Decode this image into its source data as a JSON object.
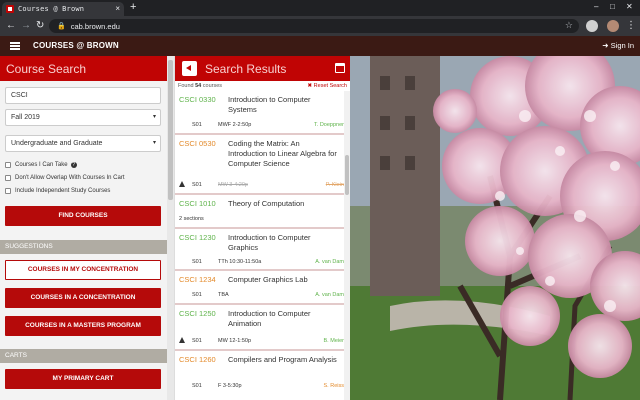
{
  "browser": {
    "tab_title": "Courses @ Brown",
    "tab_close": "×",
    "new_tab": "+",
    "win_min": "–",
    "win_max": "□",
    "win_close": "✕",
    "url": "cab.brown.edu",
    "lock_glyph": "🔒",
    "star_glyph": "☆",
    "back_glyph": "←",
    "forward_glyph": "→",
    "reload_glyph": "↻"
  },
  "header": {
    "brand": "COURSES @ BROWN",
    "signin": "➜ Sign In"
  },
  "search": {
    "title": "Course Search",
    "keyword_value": "CSCI",
    "term_value": "Fall 2019",
    "level_value": "Undergraduate and Graduate",
    "check_can_take": "Courses I Can Take",
    "check_no_overlap": "Don't Allow Overlap With Courses In Cart",
    "check_independent": "Include Independent Study Courses",
    "find_button": "FIND COURSES",
    "help_glyph": "?",
    "caret_glyph": "▾"
  },
  "suggestions": {
    "heading": "SUGGESTIONS",
    "items": [
      "COURSES IN MY CONCENTRATION",
      "COURSES IN A CONCENTRATION",
      "COURSES IN A MASTERS PROGRAM"
    ]
  },
  "carts": {
    "heading": "CARTS",
    "primary": "MY PRIMARY CART"
  },
  "results": {
    "title": "Search Results",
    "found_prefix": "Found ",
    "found_count": "54",
    "found_suffix": " courses",
    "reset": "✖ Reset Search",
    "items": [
      {
        "code": "CSCI 0330",
        "title": "Introduction to Computer Systems",
        "section": "S01",
        "time": "MWF 2-2:50p",
        "instructor": "T. Doeppner",
        "code_color": "green",
        "inst_color": "green",
        "warn": false,
        "strike": false,
        "sections_text": ""
      },
      {
        "code": "CSCI 0530",
        "title": "Coding the Matrix: An Introduction to Linear Algebra for Computer Science",
        "section": "S01",
        "time": "MW 3-4:20p",
        "instructor": "P. Klein",
        "code_color": "orange",
        "inst_color": "orange",
        "warn": true,
        "strike": true,
        "sections_text": ""
      },
      {
        "code": "CSCI 1010",
        "title": "Theory of Computation",
        "section": "",
        "time": "",
        "instructor": "",
        "code_color": "green",
        "inst_color": "",
        "warn": false,
        "strike": false,
        "sections_text": "2 sections"
      },
      {
        "code": "CSCI 1230",
        "title": "Introduction to Computer Graphics",
        "section": "S01",
        "time": "TTh 10:30-11:50a",
        "instructor": "A. van Dam",
        "code_color": "green",
        "inst_color": "green",
        "warn": false,
        "strike": false,
        "sections_text": ""
      },
      {
        "code": "CSCI 1234",
        "title": "Computer Graphics Lab",
        "section": "S01",
        "time": "TBA",
        "instructor": "A. van Dam",
        "code_color": "orange",
        "inst_color": "green",
        "warn": false,
        "strike": false,
        "sections_text": ""
      },
      {
        "code": "CSCI 1250",
        "title": "Introduction to Computer Animation",
        "section": "S01",
        "time": "MW 12-1:50p",
        "instructor": "B. Meier",
        "code_color": "green",
        "inst_color": "green",
        "warn": true,
        "strike": false,
        "sections_text": ""
      },
      {
        "code": "CSCI 1260",
        "title": "Compilers and Program Analysis",
        "section": "S01",
        "time": "F 3-5:30p",
        "instructor": "S. Reiss",
        "code_color": "orange",
        "inst_color": "orange",
        "warn": false,
        "strike": false,
        "sections_text": ""
      }
    ]
  },
  "colors": {
    "brand_red": "#c00404",
    "header_brown": "#3b1a14",
    "open_green": "#5fb34b",
    "closed_orange": "#e38a2b"
  }
}
